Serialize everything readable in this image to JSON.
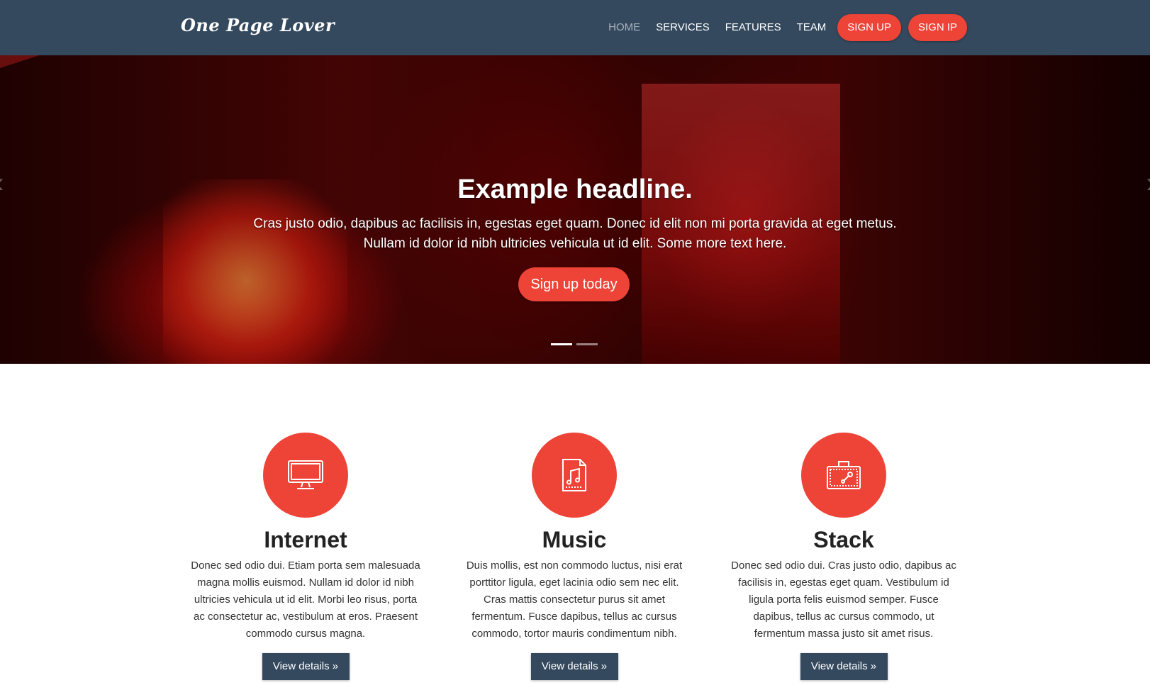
{
  "brand": "One Page Lover",
  "nav": {
    "links": [
      {
        "label": "HOME",
        "active": true
      },
      {
        "label": "SERVICES",
        "active": false
      },
      {
        "label": "FEATURES",
        "active": false
      },
      {
        "label": "TEAM",
        "active": false
      }
    ],
    "signup_label": "SIGN UP",
    "signin_label": "SIGN IP"
  },
  "hero": {
    "headline": "Example headline.",
    "text": "Cras justo odio, dapibus ac facilisis in, egestas eget quam. Donec id elit non mi porta gravida at eget metus. Nullam id dolor id nibh ultricies vehicula ut id elit. Some more text here.",
    "button_label": "Sign up today",
    "prev_glyph": "‹",
    "next_glyph": "›",
    "slide_count": 2,
    "active_slide": 1
  },
  "features": [
    {
      "icon": "monitor-icon",
      "title": "Internet",
      "text": "Donec sed odio dui. Etiam porta sem malesuada magna mollis euismod. Nullam id dolor id nibh ultricies vehicula ut id elit. Morbi leo risus, porta ac consectetur ac, vestibulum at eros. Praesent commodo cursus magna.",
      "button_label": "View details »"
    },
    {
      "icon": "music-file-icon",
      "title": "Music",
      "text": "Duis mollis, est non commodo luctus, nisi erat porttitor ligula, eget lacinia odio sem nec elit. Cras mattis consectetur purus sit amet fermentum. Fusce dapibus, tellus ac cursus commodo, tortor mauris condimentum nibh.",
      "button_label": "View details »"
    },
    {
      "icon": "toolbox-icon",
      "title": "Stack",
      "text": "Donec sed odio dui. Cras justo odio, dapibus ac facilisis in, egestas eget quam. Vestibulum id ligula porta felis euismod semper. Fusce dapibus, tellus ac cursus commodo, ut fermentum massa justo sit amet risus.",
      "button_label": "View details »"
    }
  ],
  "colors": {
    "navbar": "#34495e",
    "accent": "#ee4337",
    "button_dark": "#34495e"
  }
}
